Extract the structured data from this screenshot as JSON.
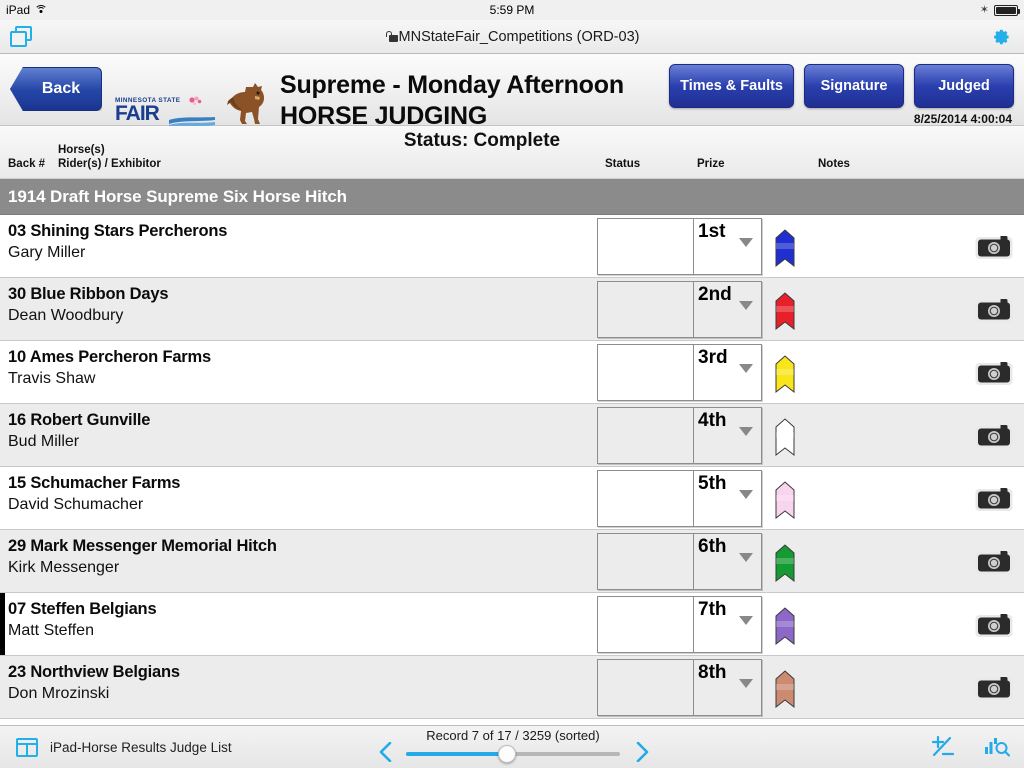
{
  "status_bar": {
    "device": "iPad",
    "wifi_icon": "wifi-icon",
    "time": "5:59 PM",
    "bluetooth_icon": "bluetooth-icon",
    "battery_icon": "battery-icon"
  },
  "fm_toolbar": {
    "layout_icon": "layout-switch-icon",
    "lock_icon": "lock-icon",
    "file_title": "MNStateFair_Competitions (ORD-03)",
    "gear_icon": "gear-icon"
  },
  "header": {
    "back_label": "Back",
    "logo_line1": "MINNESOTA STATE",
    "logo_line2": "FAIR",
    "horse_icon": "horse-icon",
    "title_line1": "Supreme - Monday Afternoon",
    "title_line2": "HORSE JUDGING",
    "buttons": [
      {
        "label": "Times & Faults",
        "name": "times-and-faults-button"
      },
      {
        "label": "Signature",
        "name": "signature-button"
      },
      {
        "label": "Judged",
        "name": "judged-button"
      }
    ],
    "timestamp": "8/25/2014 4:00:04"
  },
  "columns": {
    "status_summary": "Status:  Complete",
    "back_number": "Back #",
    "horses": "Horse(s)",
    "riders": "Rider(s) / Exhibitor",
    "status": "Status",
    "prize": "Prize",
    "notes": "Notes"
  },
  "group": {
    "title": "1914 Draft Horse Supreme Six Horse Hitch"
  },
  "rows": [
    {
      "horse": "03 Shining Stars Percherons",
      "rider": "Gary Miller",
      "status": "",
      "prize": "1st",
      "ribbon_color": "#1f2fd0",
      "ribbon_name": "blue-ribbon",
      "camera_icon": "camera-icon",
      "selected": false
    },
    {
      "horse": "30 Blue Ribbon Days",
      "rider": "Dean Woodbury",
      "status": "",
      "prize": "2nd",
      "ribbon_color": "#e8202a",
      "ribbon_name": "red-ribbon",
      "camera_icon": "camera-icon",
      "selected": false
    },
    {
      "horse": "10 Ames Percheron Farms",
      "rider": "Travis Shaw",
      "status": "",
      "prize": "3rd",
      "ribbon_color": "#f9e61a",
      "ribbon_name": "yellow-ribbon",
      "camera_icon": "camera-icon",
      "selected": false
    },
    {
      "horse": "16 Robert Gunville",
      "rider": "Bud Miller",
      "status": "",
      "prize": "4th",
      "ribbon_color": "#ffffff",
      "ribbon_name": "white-ribbon",
      "camera_icon": "camera-icon",
      "selected": false
    },
    {
      "horse": "15 Schumacher Farms",
      "rider": "David Schumacher",
      "status": "",
      "prize": "5th",
      "ribbon_color": "#f9d4ee",
      "ribbon_name": "pink-ribbon",
      "camera_icon": "camera-icon",
      "selected": false
    },
    {
      "horse": "29 Mark Messenger Memorial Hitch",
      "rider": "Kirk Messenger",
      "status": "",
      "prize": "6th",
      "ribbon_color": "#159b33",
      "ribbon_name": "green-ribbon",
      "camera_icon": "camera-icon",
      "selected": false
    },
    {
      "horse": "07 Steffen Belgians",
      "rider": "Matt Steffen",
      "status": "",
      "prize": "7th",
      "ribbon_color": "#8c68c8",
      "ribbon_name": "purple-ribbon",
      "camera_icon": "camera-icon",
      "selected": true
    },
    {
      "horse": "23 Northview Belgians",
      "rider": "Don Mrozinski",
      "status": "",
      "prize": "8th",
      "ribbon_color": "#cc8a71",
      "ribbon_name": "brown-ribbon",
      "camera_icon": "camera-icon",
      "selected": false
    }
  ],
  "bottom_bar": {
    "layout_icon": "layout-icon",
    "layout_name": "iPad-Horse Results Judge List",
    "prev_icon": "chevron-left-icon",
    "next_icon": "chevron-right-icon",
    "record_label": "Record 7 of 17 / 3259 (sorted)",
    "slider_percent": 47,
    "plus_minus_icon": "plus-minus-icon",
    "sort_find_icon": "sort-find-icon"
  },
  "colors": {
    "accent_blue": "#23aae8",
    "button_blue": "#2a3fae",
    "group_gray": "#8b8b8b",
    "row_alt": "#ececec"
  }
}
